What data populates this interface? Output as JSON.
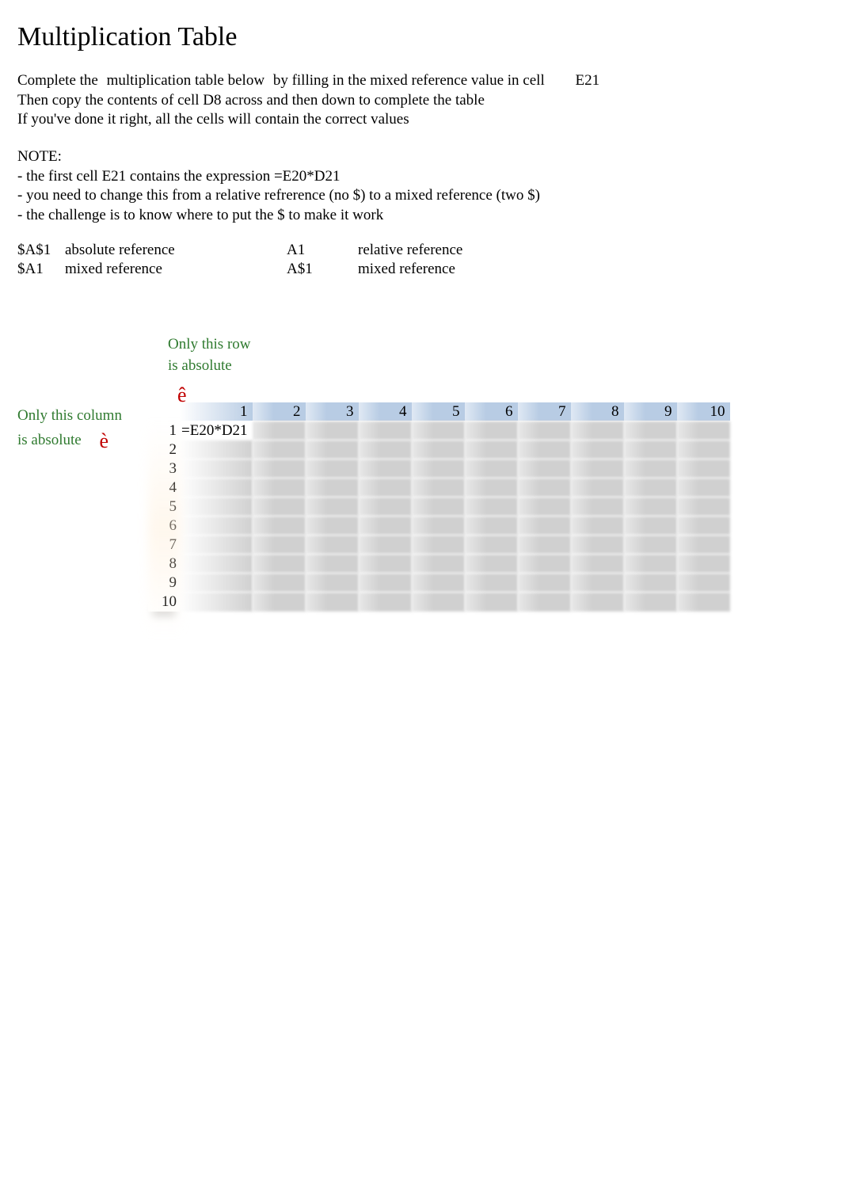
{
  "title": "Multiplication Table",
  "instructions": {
    "line1_a": "Complete the",
    "line1_b": "multiplication table below",
    "line1_c": "by filling in the mixed reference value in cell",
    "line1_cell": "E21",
    "line2": "Then copy the contents of cell D8 across and then down to complete the table",
    "line3": "If you've done it right, all the cells will contain the correct values"
  },
  "note": {
    "heading": "NOTE:",
    "l1": "- the first cell E21 contains the expression =E20*D21",
    "l2": "- you need to change this from a relative refrerence (no $) to a mixed reference (two $)",
    "l3": "- the challenge is to know where to put the $ to make it work"
  },
  "refs": {
    "r1c1": "$A$1",
    "r1c2": "absolute reference",
    "r1c3": "A1",
    "r1c4": "relative reference",
    "r2c1": "$A1",
    "r2c2": "mixed reference",
    "r2c3": "A$1",
    "r2c4": "mixed reference"
  },
  "hints": {
    "row1": "Only this row",
    "row2": "is absolute",
    "arrow_down": "ê",
    "col1": "Only this column",
    "col2": "is absolute",
    "arrow_right": "è"
  },
  "table": {
    "col_headers": [
      "1",
      "2",
      "3",
      "4",
      "5",
      "6",
      "7",
      "8",
      "9",
      "10"
    ],
    "row_headers": [
      "1",
      "2",
      "3",
      "4",
      "5",
      "6",
      "7",
      "8",
      "9",
      "10"
    ],
    "formula": "=E20*D21"
  }
}
